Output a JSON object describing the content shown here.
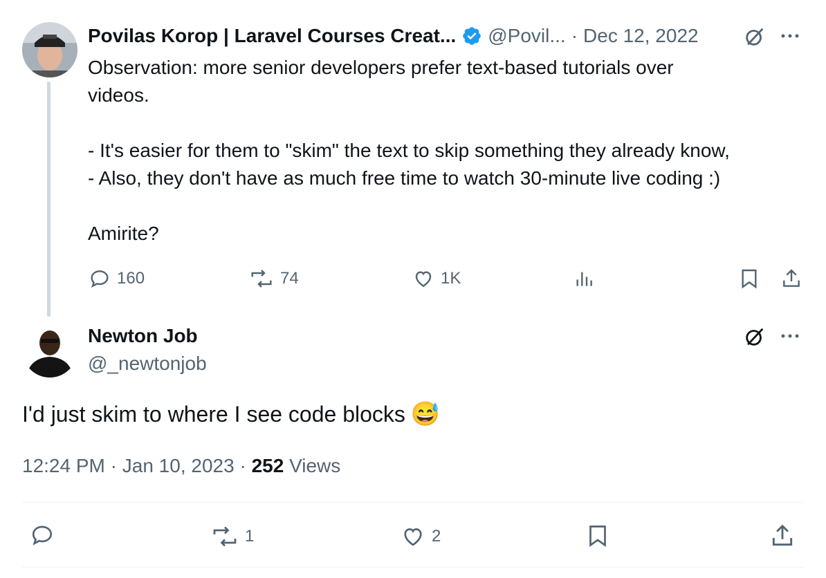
{
  "quoted_tweet": {
    "author_name": "Povilas Korop | Laravel Courses Creat...",
    "author_handle": "@Povil...",
    "separator": "·",
    "date": "Dec 12, 2022",
    "text": "Observation: more senior developers prefer text-based tutorials over\nvideos.\n\n- It's easier for them to \"skim\" the text to skip something they already know,\n- Also, they don't have as much free time to watch 30-minute live coding :)\n\nAmirite?",
    "stats": {
      "replies": "160",
      "retweets": "74",
      "likes": "1K"
    }
  },
  "reply_tweet": {
    "author_name": "Newton Job",
    "author_handle": "@_newtonjob",
    "text": "I'd just skim to where I see code blocks",
    "emoji": "😅",
    "time": "12:24 PM",
    "separator": "·",
    "date": "Jan 10, 2023",
    "views_count": "252",
    "views_label": "Views",
    "stats": {
      "retweets": "1",
      "likes": "2"
    }
  },
  "colors": {
    "verified": "#1d9bf0",
    "muted": "#536471",
    "text": "#0f1419"
  },
  "icons": [
    "verified-badge-icon",
    "grok-icon",
    "more-icon",
    "reply-icon",
    "retweet-icon",
    "like-icon",
    "views-icon",
    "bookmark-icon",
    "share-icon"
  ]
}
